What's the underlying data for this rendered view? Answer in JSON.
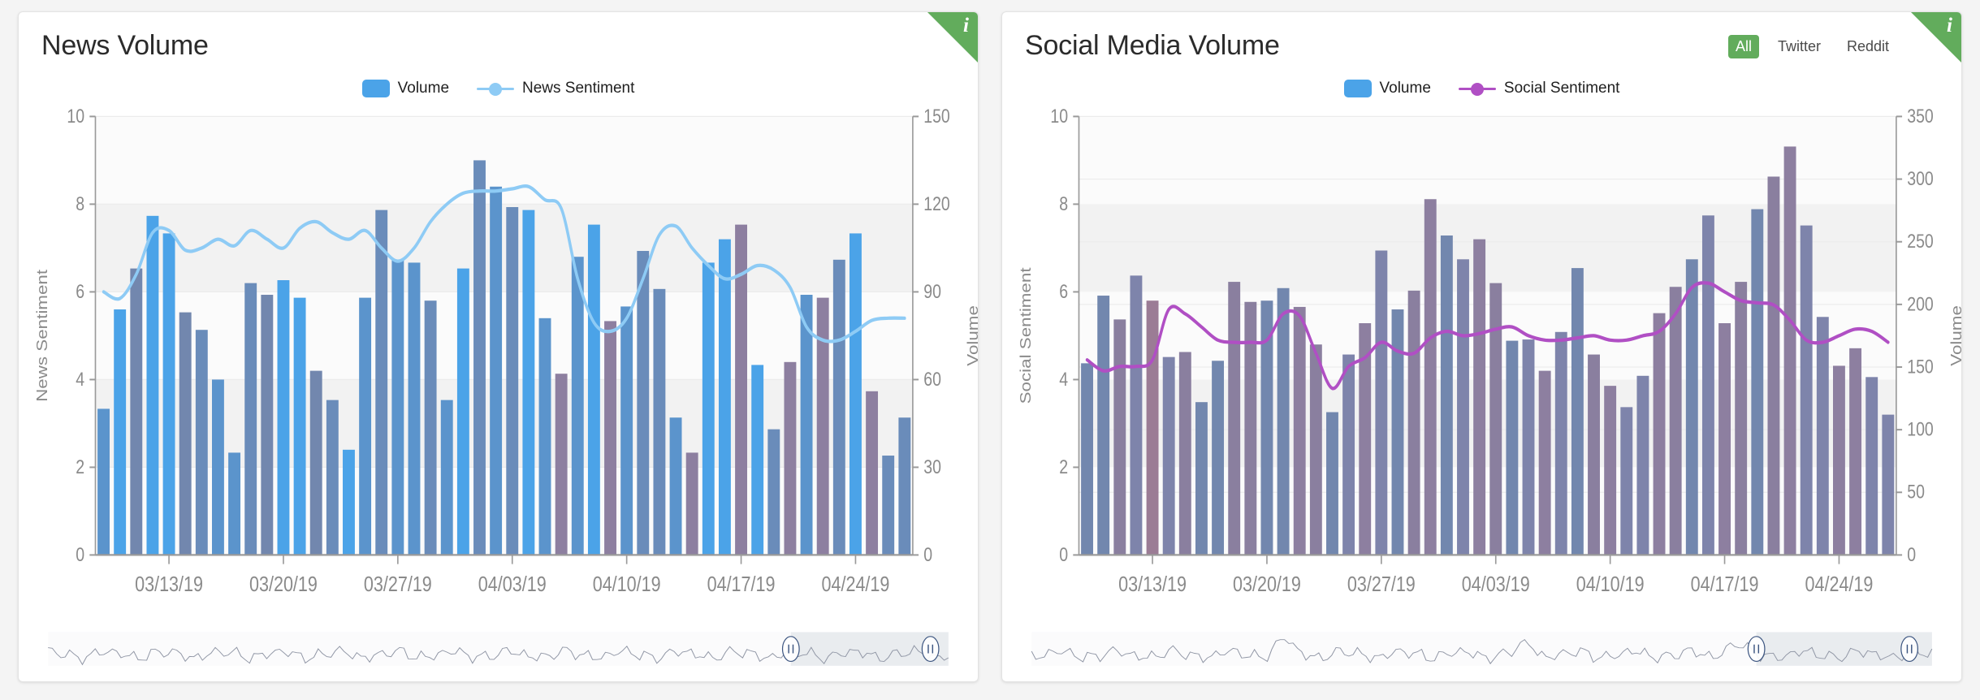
{
  "layout": {
    "background": "#f4f4f4",
    "card_background": "#ffffff"
  },
  "colors": {
    "accent_green": "#62ac5c",
    "volume_blue": "#4ba3e8",
    "news_sentiment_line": "#8ecbf5",
    "social_sentiment_line": "#b04fc4",
    "bar_slate": "#7287ae",
    "bar_mauve": "#8d7fa0",
    "axis_text": "#8a8a8a",
    "title_text": "#2b2b2b"
  },
  "cards": [
    {
      "id": "news-volume",
      "title": "News Volume",
      "info_icon": "i",
      "tabs": [],
      "legend": [
        {
          "type": "box",
          "label": "Volume",
          "color": "#4ba3e8"
        },
        {
          "type": "line",
          "label": "News Sentiment",
          "color": "#8ecbf5"
        }
      ],
      "range_slider": {
        "handle_glyph": "II",
        "left_handle_pct": 82.5,
        "right_handle_pct": 98.0,
        "selection_fill": "#e9ecef"
      }
    },
    {
      "id": "social-media-volume",
      "title": "Social Media Volume",
      "info_icon": "i",
      "tabs": [
        {
          "label": "All",
          "active": true
        },
        {
          "label": "Twitter",
          "active": false
        },
        {
          "label": "Reddit",
          "active": false
        }
      ],
      "legend": [
        {
          "type": "box",
          "label": "Volume",
          "color": "#4ba3e8"
        },
        {
          "type": "line",
          "label": "Social Sentiment",
          "color": "#b04fc4"
        }
      ],
      "range_slider": {
        "handle_glyph": "II",
        "left_handle_pct": 80.5,
        "right_handle_pct": 97.5,
        "selection_fill": "#e9ecef"
      }
    }
  ],
  "chart_data": [
    {
      "id": "news-volume",
      "type": "bar",
      "title": "News Volume",
      "xlabel": "",
      "ylabel": "News Sentiment",
      "y2label": "Volume",
      "ylim": [
        0,
        10
      ],
      "y2lim": [
        0,
        150
      ],
      "yticks": [
        0,
        2,
        4,
        6,
        8,
        10
      ],
      "y2ticks": [
        0,
        30,
        60,
        90,
        120,
        150
      ],
      "grid": true,
      "legend_position": "top-center",
      "tick_labels": [
        "03/13/19",
        "03/20/19",
        "03/27/19",
        "04/03/19",
        "04/10/19",
        "04/17/19",
        "04/24/19"
      ],
      "tick_indices": [
        4,
        11,
        18,
        25,
        32,
        39,
        46
      ],
      "categories": [
        "03/09/19",
        "03/10/19",
        "03/11/19",
        "03/12/19",
        "03/13/19",
        "03/14/19",
        "03/15/19",
        "03/16/19",
        "03/17/19",
        "03/18/19",
        "03/19/19",
        "03/20/19",
        "03/21/19",
        "03/22/19",
        "03/23/19",
        "03/24/19",
        "03/25/19",
        "03/26/19",
        "03/27/19",
        "03/28/19",
        "03/29/19",
        "03/30/19",
        "03/31/19",
        "04/01/19",
        "04/02/19",
        "04/03/19",
        "04/04/19",
        "04/05/19",
        "04/06/19",
        "04/07/19",
        "04/08/19",
        "04/09/19",
        "04/10/19",
        "04/11/19",
        "04/12/19",
        "04/13/19",
        "04/14/19",
        "04/15/19",
        "04/16/19",
        "04/17/19",
        "04/18/19",
        "04/19/19",
        "04/20/19",
        "04/21/19",
        "04/22/19",
        "04/23/19",
        "04/24/19",
        "04/25/19",
        "04/26/19",
        "04/27/19",
        "04/28/19"
      ],
      "series": [
        {
          "name": "Volume",
          "axis": "right",
          "kind": "bar",
          "values": [
            50,
            84,
            98,
            116,
            110,
            83,
            77,
            60,
            35,
            93,
            89,
            94,
            88,
            63,
            53,
            36,
            88,
            118,
            101,
            100,
            87,
            53,
            98,
            135,
            126,
            119,
            118,
            81,
            62,
            102,
            113,
            80,
            85,
            104,
            91,
            47,
            35,
            100,
            108,
            113,
            65,
            43,
            66,
            89,
            88,
            101,
            110,
            56,
            34,
            47
          ]
        },
        {
          "name": "News Sentiment",
          "axis": "left",
          "kind": "line",
          "values": [
            6.0,
            5.85,
            6.4,
            7.35,
            7.4,
            6.95,
            7.0,
            7.2,
            7.05,
            7.4,
            7.2,
            7.0,
            7.45,
            7.6,
            7.35,
            7.2,
            7.4,
            7.0,
            6.7,
            7.0,
            7.6,
            8.0,
            8.25,
            8.3,
            8.3,
            8.35,
            8.4,
            8.1,
            7.9,
            6.3,
            5.3,
            5.1,
            5.4,
            6.3,
            7.3,
            7.5,
            7.0,
            6.6,
            6.3,
            6.4,
            6.6,
            6.5,
            6.1,
            5.2,
            4.9,
            4.9,
            5.1,
            5.35,
            5.4,
            5.4
          ]
        }
      ]
    },
    {
      "id": "social-media-volume",
      "type": "bar",
      "title": "Social Media Volume",
      "xlabel": "",
      "ylabel": "Social Sentiment",
      "y2label": "Volume",
      "ylim": [
        0,
        10
      ],
      "y2lim": [
        0,
        350
      ],
      "yticks": [
        0,
        2,
        4,
        6,
        8,
        10
      ],
      "y2ticks": [
        0,
        50,
        100,
        150,
        200,
        250,
        300,
        350
      ],
      "grid": true,
      "legend_position": "top-center",
      "tick_labels": [
        "03/13/19",
        "03/20/19",
        "03/27/19",
        "04/03/19",
        "04/10/19",
        "04/17/19",
        "04/24/19"
      ],
      "tick_indices": [
        4,
        11,
        18,
        25,
        32,
        39,
        46
      ],
      "categories": [
        "03/09/19",
        "03/10/19",
        "03/11/19",
        "03/12/19",
        "03/13/19",
        "03/14/19",
        "03/15/19",
        "03/16/19",
        "03/17/19",
        "03/18/19",
        "03/19/19",
        "03/20/19",
        "03/21/19",
        "03/22/19",
        "03/23/19",
        "03/24/19",
        "03/25/19",
        "03/26/19",
        "03/27/19",
        "03/28/19",
        "03/29/19",
        "03/30/19",
        "03/31/19",
        "04/01/19",
        "04/02/19",
        "04/03/19",
        "04/04/19",
        "04/05/19",
        "04/06/19",
        "04/07/19",
        "04/08/19",
        "04/09/19",
        "04/10/19",
        "04/11/19",
        "04/12/19",
        "04/13/19",
        "04/14/19",
        "04/15/19",
        "04/16/19",
        "04/17/19",
        "04/18/19",
        "04/19/19",
        "04/20/19",
        "04/21/19",
        "04/22/19",
        "04/23/19",
        "04/24/19",
        "04/25/19",
        "04/26/19",
        "04/27/19",
        "04/28/19"
      ],
      "series": [
        {
          "name": "Volume",
          "axis": "right",
          "kind": "bar",
          "values": [
            153,
            207,
            188,
            223,
            203,
            158,
            162,
            122,
            155,
            218,
            202,
            203,
            213,
            198,
            168,
            114,
            160,
            185,
            243,
            196,
            211,
            284,
            255,
            236,
            252,
            217,
            171,
            172,
            147,
            178,
            229,
            160,
            135,
            118,
            143,
            193,
            214,
            236,
            271,
            185,
            218,
            276,
            302,
            326,
            263,
            190,
            151,
            165,
            142,
            112
          ]
        },
        {
          "name": "Social Sentiment",
          "axis": "left",
          "kind": "line",
          "values": [
            4.45,
            4.2,
            4.3,
            4.3,
            4.45,
            5.6,
            5.5,
            5.2,
            4.9,
            4.85,
            4.85,
            4.9,
            5.5,
            5.45,
            4.6,
            3.8,
            4.3,
            4.5,
            4.85,
            4.65,
            4.6,
            4.95,
            5.1,
            5.0,
            5.05,
            5.15,
            5.2,
            5.0,
            4.9,
            4.9,
            4.95,
            5.0,
            4.9,
            4.9,
            5.0,
            5.1,
            5.5,
            6.1,
            6.2,
            6.0,
            5.8,
            5.75,
            5.7,
            5.35,
            4.9,
            4.85,
            5.0,
            5.15,
            5.1,
            4.85
          ]
        }
      ],
      "sparkline_peaks": [
        0.28,
        0.55,
        0.78
      ]
    }
  ]
}
